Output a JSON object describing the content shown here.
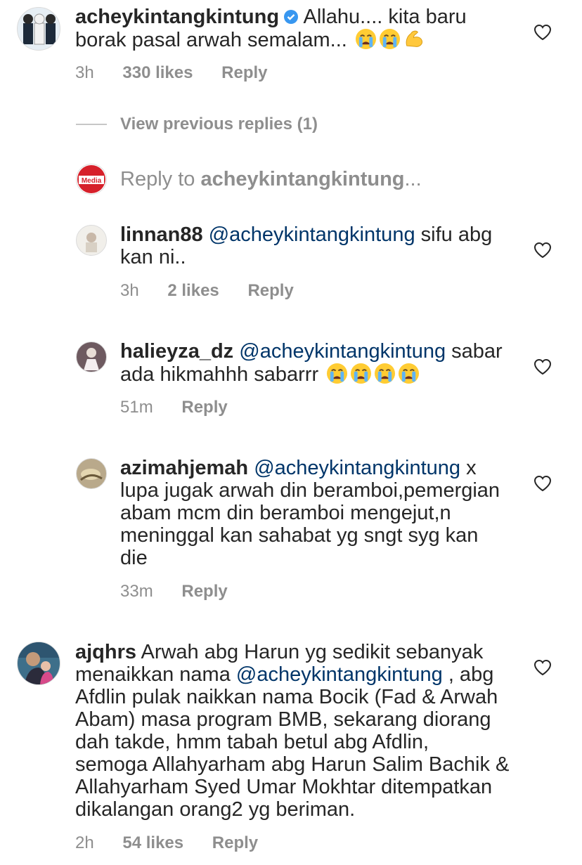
{
  "comments": {
    "c1": {
      "username": "acheykintangkintung",
      "text_a": " Allahu.... kita baru",
      "text_b": "borak pasal arwah semalam...",
      "time": "3h",
      "likes": "330 likes",
      "reply": "Reply"
    },
    "view_previous": "View previous replies (1)",
    "reply_to": {
      "prefix": "Reply to ",
      "user": "acheykintangkintung",
      "suffix": "...",
      "avatar_text": "Media"
    },
    "r1": {
      "username": "linnan88",
      "mention": "@acheykintangkintung",
      "text_a": " sifu abg",
      "text_b": "kan ni..",
      "time": "3h",
      "likes": "2 likes",
      "reply": "Reply"
    },
    "r2": {
      "username": "halieyza_dz",
      "mention": "@acheykintangkintung",
      "text_a": " sabar",
      "text_b": "ada hikmahhh sabarrr ",
      "time": "51m",
      "reply": "Reply"
    },
    "r3": {
      "username": "azimahjemah",
      "mention": "@acheykintangkintung",
      "text_a": " x",
      "lines": [
        "lupa jugak arwah din beramboi,pemergian",
        "abam mcm din beramboi mengejut,n",
        "meninggal kan sahabat yg sngt syg kan",
        "die"
      ],
      "time": "33m",
      "reply": "Reply"
    },
    "c2": {
      "username": "ajqhrs",
      "text_a": " Arwah abg Harun yg sedikit sebanyak",
      "line2_a": "menaikkan nama ",
      "mention": "@acheykintangkintung",
      "line2_b": " , abg",
      "lines": [
        "Afdlin pulak naikkan nama Bocik (Fad & Arwah",
        "Abam) masa program BMB, sekarang diorang",
        "dah takde, hmm tabah betul abg Afdlin,",
        "semoga Allahyarham abg Harun Salim Bachik &",
        "Allahyarham Syed Umar Mokhtar ditempatkan",
        "dikalangan orang2 yg beriman."
      ],
      "time": "2h",
      "likes": "54 likes",
      "reply": "Reply"
    }
  },
  "colors": {
    "text": "#262626",
    "meta": "#8e8e8e",
    "mention": "#003569",
    "verified": "#3897f0"
  }
}
